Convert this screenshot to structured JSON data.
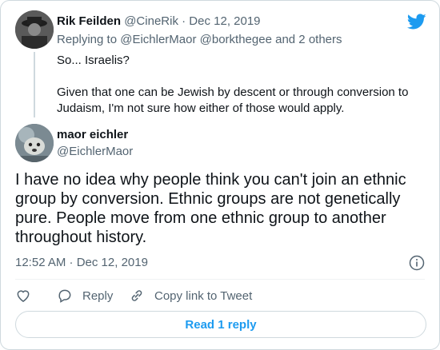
{
  "parent": {
    "name": "Rik Feilden",
    "handle": "@CineRik",
    "separator": "·",
    "date": "Dec 12, 2019",
    "replying_prefix": "Replying to",
    "replying_to": "@EichlerMaor @borkthegee",
    "replying_suffix": "and 2 others",
    "paragraphs": [
      "So... Israelis?",
      "Given that one can be Jewish by descent or through conversion to Judaism, I'm not sure how either of those would apply."
    ]
  },
  "tweet": {
    "name": "maor eichler",
    "handle": "@EichlerMaor",
    "text": "I have no idea why people think you can't join an ethnic group by conversion. Ethnic groups are not genetically pure. People move from one ethnic group to another throughout history.",
    "timestamp": "12:52 AM · Dec 12, 2019"
  },
  "actions": {
    "reply_label": "Reply",
    "copy_label": "Copy link to Tweet",
    "read_reply_label": "Read 1 reply"
  },
  "icons": {
    "brand": "twitter-bird-icon",
    "info": "info-icon",
    "like": "heart-icon",
    "reply": "reply-bubble-icon",
    "copy": "link-icon"
  },
  "colors": {
    "accent": "#1d9bf0",
    "muted": "#536471",
    "text": "#0f1419",
    "border": "#cfd9de"
  }
}
